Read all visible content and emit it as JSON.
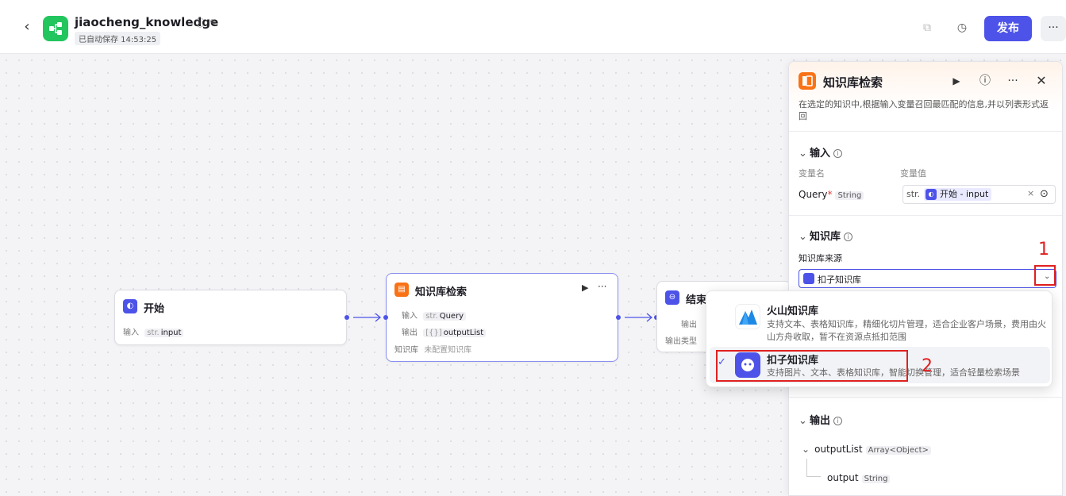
{
  "header": {
    "app_name": "jiaocheng_knowledge",
    "autosave": "已自动保存 14:53:25",
    "publish_label": "发布",
    "more_label": "···"
  },
  "nodes": {
    "start": {
      "title": "开始",
      "input_label": "输入",
      "input_type": "str.",
      "input_name": "input"
    },
    "kb": {
      "title": "知识库检索",
      "input_label": "输入",
      "input_type": "str.",
      "input_name": "Query",
      "output_label": "输出",
      "output_type": "[{}]",
      "output_name": "outputList",
      "kb_label": "知识库",
      "kb_value": "未配置知识库"
    },
    "end": {
      "title": "结束",
      "output_label": "输出",
      "output_type_label": "输出类型"
    }
  },
  "panel": {
    "title": "知识库检索",
    "description": "在选定的知识中,根据输入变量召回最匹配的信息,并以列表形式返回",
    "input_section": {
      "title": "输入",
      "col_name": "变量名",
      "col_value": "变量值",
      "var_name": "Query",
      "var_type": "String",
      "value_type": "str.",
      "value_ref": "开始 - input",
      "clear": "×"
    },
    "kb_section": {
      "title": "知识库",
      "source_label": "知识库来源",
      "selected": "扣子知识库"
    },
    "output_section": {
      "title": "输出",
      "list_name": "outputList",
      "list_type": "Array<Object>",
      "child_name": "output",
      "child_type": "String"
    }
  },
  "dropdown": {
    "options": [
      {
        "title": "火山知识库",
        "desc": "支持文本、表格知识库，精细化切片管理，适合企业客户场景，费用由火山方舟收取，暂不在资源点抵扣范围",
        "selected": false
      },
      {
        "title": "扣子知识库",
        "desc": "支持图片、文本、表格知识库，智能切换管理，适合轻量检索场景",
        "selected": true
      }
    ]
  },
  "annotations": {
    "one": "1",
    "two": "2"
  },
  "colors": {
    "accent": "#4d53e8",
    "kb_orange": "#f97316",
    "logo_green": "#22c55e",
    "annotation_red": "#e02020"
  }
}
